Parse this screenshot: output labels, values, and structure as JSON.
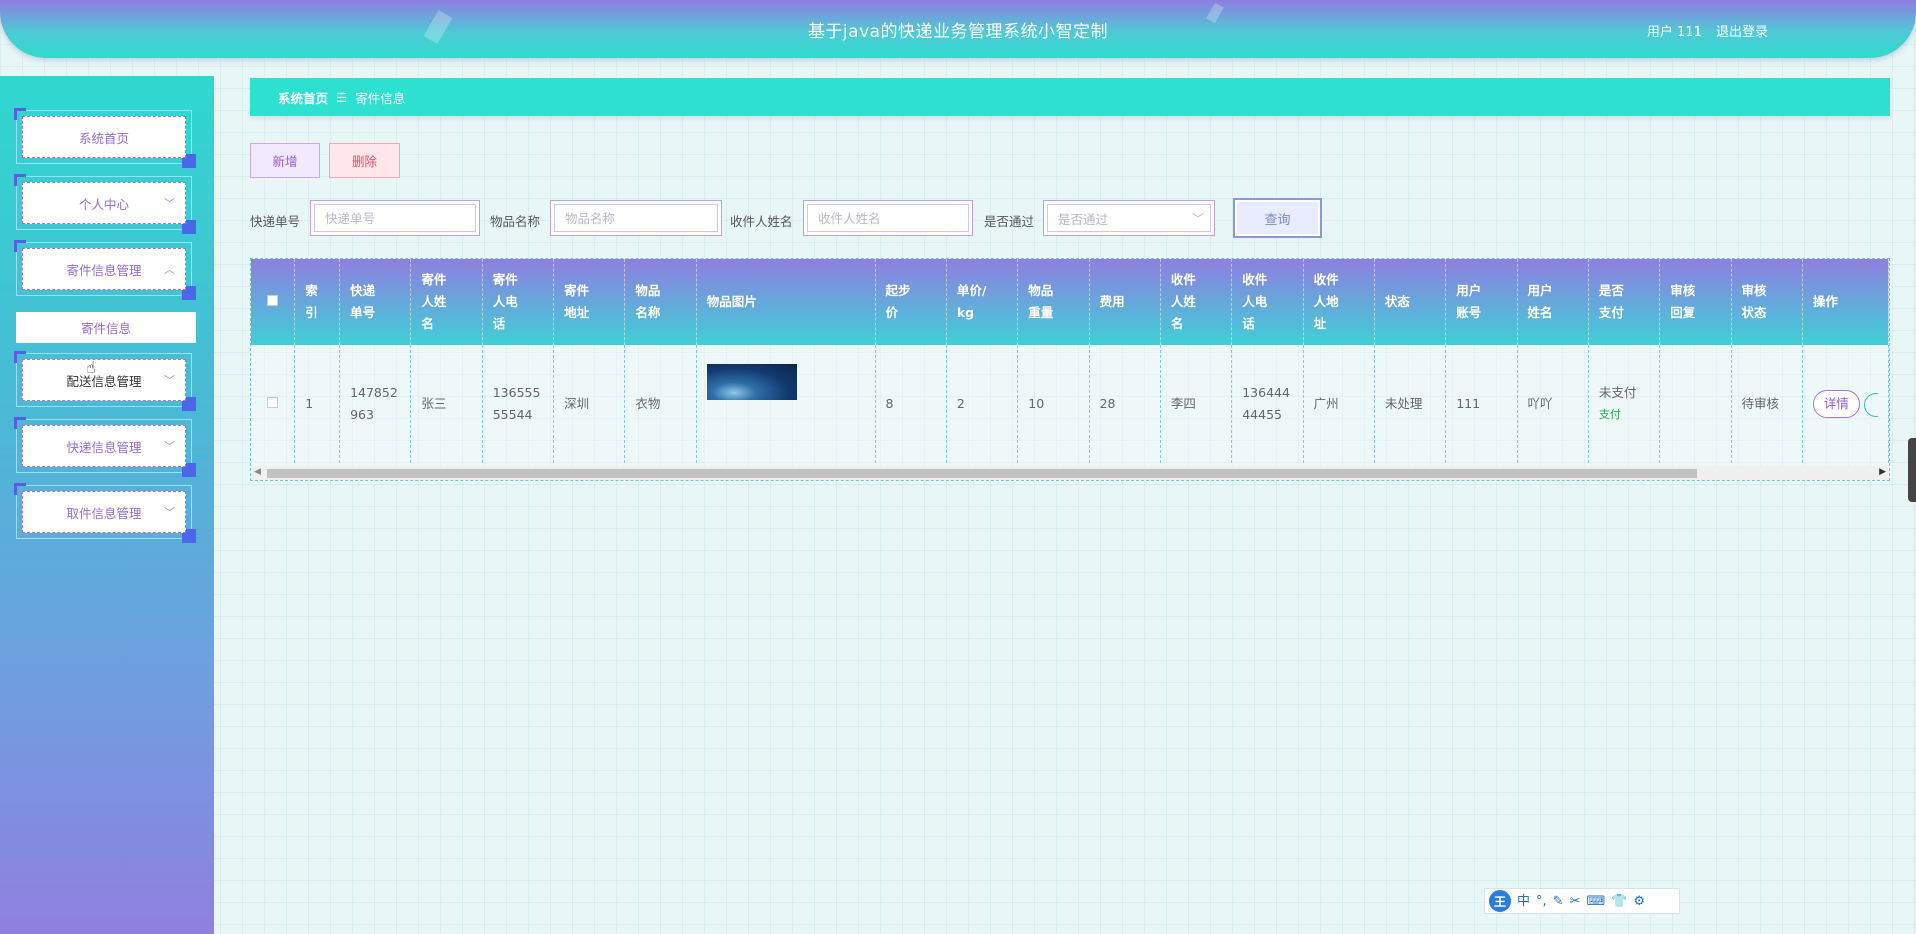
{
  "header": {
    "title": "基于java的快递业务管理系统小智定制",
    "user_label": "用户 111",
    "logout_label": "退出登录"
  },
  "sidebar": {
    "items": [
      {
        "label": "系统首页",
        "has_chevron": false
      },
      {
        "label": "个人中心",
        "has_chevron": true,
        "chevron": "﹀"
      },
      {
        "label": "寄件信息管理",
        "has_chevron": true,
        "chevron": "︿"
      },
      {
        "label": "配送信息管理",
        "has_chevron": true,
        "chevron": "﹀"
      },
      {
        "label": "快递信息管理",
        "has_chevron": true,
        "chevron": "﹀"
      },
      {
        "label": "取件信息管理",
        "has_chevron": true,
        "chevron": "﹀"
      }
    ],
    "submenu_label": "寄件信息"
  },
  "breadcrumb": {
    "home": "系统首页",
    "separator": "☰",
    "current": "寄件信息"
  },
  "actions": {
    "add_label": "新增",
    "delete_label": "删除"
  },
  "search": {
    "tracking_label": "快递单号",
    "tracking_placeholder": "快递单号",
    "item_label": "物品名称",
    "item_placeholder": "物品名称",
    "receiver_label": "收件人姓名",
    "receiver_placeholder": "收件人姓名",
    "approved_label": "是否通过",
    "approved_placeholder": "是否通过",
    "query_label": "查询"
  },
  "table": {
    "headers": [
      "索引",
      "快递单号",
      "寄件人姓名",
      "寄件人电话",
      "寄件地址",
      "物品名称",
      "物品图片",
      "起步价",
      "单价/kg",
      "物品重量",
      "费用",
      "收件人姓名",
      "收件人电话",
      "收件人地址",
      "状态",
      "用户账号",
      "用户姓名",
      "是否支付",
      "审核回复",
      "审核状态",
      "操作"
    ],
    "header_display": [
      "索\n引",
      "快递\n单号",
      "寄件\n人姓\n名",
      "寄件\n人电\n话",
      "寄件\n地址",
      "物品\n名称",
      "物品图片",
      "起步\n价",
      "单价/\nkg",
      "物品\n重量",
      "费用",
      "收件\n人姓\n名",
      "收件\n人电\n话",
      "收件\n人地\n址",
      "状态",
      "用户\n账号",
      "用户\n姓名",
      "是否\n支付",
      "审核\n回复",
      "审核\n状态",
      "操作"
    ],
    "rows": [
      {
        "index": "1",
        "tracking_no": "147852963",
        "sender_name": "张三",
        "sender_phone": "13655555544",
        "sender_address": "深圳",
        "item_name": "衣物",
        "base_price": "8",
        "unit_price": "2",
        "weight": "10",
        "fee": "28",
        "receiver_name": "李四",
        "receiver_phone": "13644444455",
        "receiver_address": "广州",
        "status": "未处理",
        "user_account": "111",
        "user_name": "吖吖",
        "paid": "未支付",
        "pay_link": "支付",
        "review_reply": "",
        "review_status": "待审核",
        "detail_label": "详情"
      }
    ]
  },
  "ime_toolbar": {
    "logo": "王",
    "items": [
      "中",
      "°,",
      "✎",
      "✂",
      "⌨",
      "👕",
      "⚙"
    ]
  }
}
